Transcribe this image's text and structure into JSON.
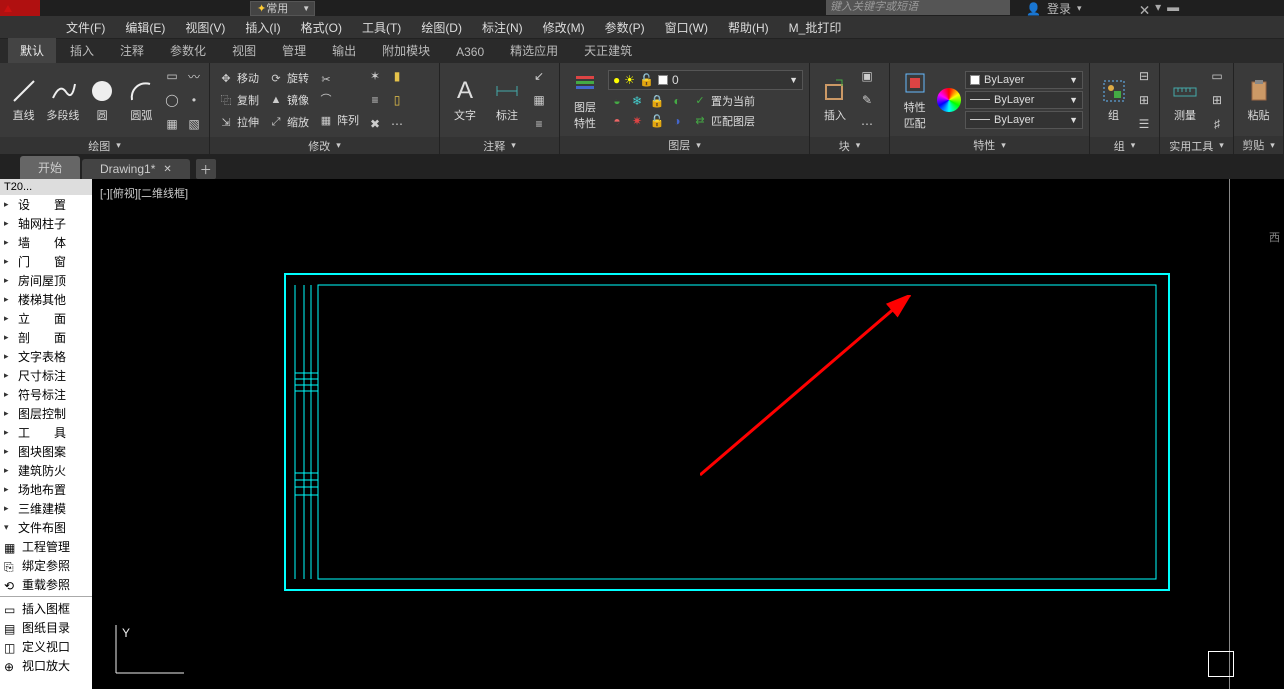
{
  "app": {
    "search_placeholder": "键入关键字或短语",
    "workspace": "常用",
    "login": "登录"
  },
  "menubar": [
    "文件(F)",
    "编辑(E)",
    "视图(V)",
    "插入(I)",
    "格式(O)",
    "工具(T)",
    "绘图(D)",
    "标注(N)",
    "修改(M)",
    "参数(P)",
    "窗口(W)",
    "帮助(H)",
    "M_批打印"
  ],
  "ribbon_tabs": [
    "默认",
    "插入",
    "注释",
    "参数化",
    "视图",
    "管理",
    "输出",
    "附加模块",
    "A360",
    "精选应用",
    "天正建筑"
  ],
  "panels": {
    "draw": {
      "title": "绘图",
      "line": "直线",
      "polyline": "多段线",
      "circle": "圆",
      "arc": "圆弧"
    },
    "modify": {
      "title": "修改",
      "move": "移动",
      "copy": "复制",
      "stretch": "拉伸",
      "rotate": "旋转",
      "mirror": "镜像",
      "scale": "缩放",
      "array": "阵列"
    },
    "annot": {
      "title": "注释",
      "text": "文字",
      "dim": "标注"
    },
    "layer": {
      "title": "图层",
      "btn": "图层\n特性",
      "current": "0",
      "setcur": "置为当前",
      "match": "匹配图层"
    },
    "block": {
      "title": "块",
      "insert": "插入"
    },
    "props": {
      "title": "特性",
      "btn": "特性\n匹配",
      "bylayer": "ByLayer"
    },
    "group": {
      "title": "组",
      "btn": "组"
    },
    "util": {
      "title": "实用工具",
      "measure": "测量"
    },
    "clip": {
      "title": "剪贴",
      "paste": "粘贴"
    }
  },
  "file_tabs": {
    "start": "开始",
    "drawing": "Drawing1*"
  },
  "viewport": {
    "label": "[-][俯视][二维线框]",
    "cube": "西"
  },
  "sidebar": {
    "head": "T20...",
    "items": [
      "设　　置",
      "轴网柱子",
      "墙　　体",
      "门　　窗",
      "房间屋顶",
      "楼梯其他",
      "立　　面",
      "剖　　面",
      "文字表格",
      "尺寸标注",
      "符号标注",
      "图层控制",
      "工　　具",
      "图块图案",
      "建筑防火",
      "场地布置",
      "三维建模",
      "文件布图"
    ],
    "tools": [
      "工程管理",
      "绑定参照",
      "重载参照",
      "插入图框",
      "图纸目录",
      "定义视口",
      "视口放大"
    ]
  }
}
